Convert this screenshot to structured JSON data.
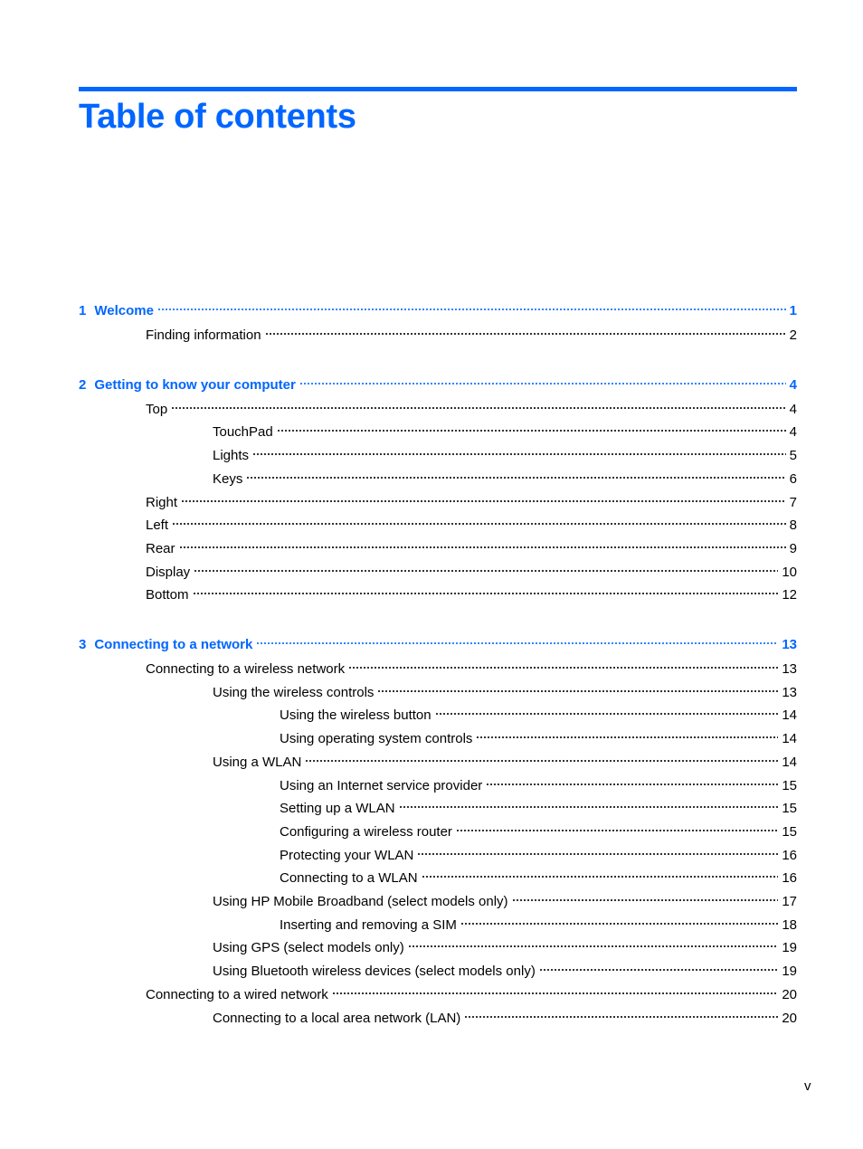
{
  "page": {
    "title": "Table of contents",
    "folio": "v",
    "accent_color": "#0066ff"
  },
  "toc": [
    {
      "level": 0,
      "number": "1",
      "label": "Welcome",
      "page": "1"
    },
    {
      "level": 1,
      "label": "Finding information",
      "page": "2"
    },
    {
      "level": 0,
      "number": "2",
      "label": "Getting to know your computer",
      "page": "4"
    },
    {
      "level": 1,
      "label": "Top",
      "page": "4"
    },
    {
      "level": 2,
      "label": "TouchPad",
      "page": "4"
    },
    {
      "level": 2,
      "label": "Lights",
      "page": "5"
    },
    {
      "level": 2,
      "label": "Keys",
      "page": "6"
    },
    {
      "level": 1,
      "label": "Right",
      "page": "7"
    },
    {
      "level": 1,
      "label": "Left",
      "page": "8"
    },
    {
      "level": 1,
      "label": "Rear",
      "page": "9"
    },
    {
      "level": 1,
      "label": "Display",
      "page": "10"
    },
    {
      "level": 1,
      "label": "Bottom",
      "page": "12"
    },
    {
      "level": 0,
      "number": "3",
      "label": "Connecting to a network",
      "page": "13"
    },
    {
      "level": 1,
      "label": "Connecting to a wireless network",
      "page": "13"
    },
    {
      "level": 2,
      "label": "Using the wireless controls",
      "page": "13"
    },
    {
      "level": 3,
      "label": "Using the wireless button",
      "page": "14"
    },
    {
      "level": 3,
      "label": "Using operating system controls",
      "page": "14"
    },
    {
      "level": 2,
      "label": "Using a WLAN",
      "page": "14"
    },
    {
      "level": 3,
      "label": "Using an Internet service provider",
      "page": "15"
    },
    {
      "level": 3,
      "label": "Setting up a WLAN",
      "page": "15"
    },
    {
      "level": 3,
      "label": "Configuring a wireless router",
      "page": "15"
    },
    {
      "level": 3,
      "label": "Protecting your WLAN",
      "page": "16"
    },
    {
      "level": 3,
      "label": "Connecting to a WLAN",
      "page": "16"
    },
    {
      "level": 2,
      "label": "Using HP Mobile Broadband (select models only)",
      "page": "17"
    },
    {
      "level": 3,
      "label": "Inserting and removing a SIM",
      "page": "18"
    },
    {
      "level": 2,
      "label": "Using GPS (select models only)",
      "page": "19"
    },
    {
      "level": 2,
      "label": "Using Bluetooth wireless devices (select models only)",
      "page": "19"
    },
    {
      "level": 1,
      "label": "Connecting to a wired network",
      "page": "20"
    },
    {
      "level": 2,
      "label": "Connecting to a local area network (LAN)",
      "page": "20"
    }
  ]
}
